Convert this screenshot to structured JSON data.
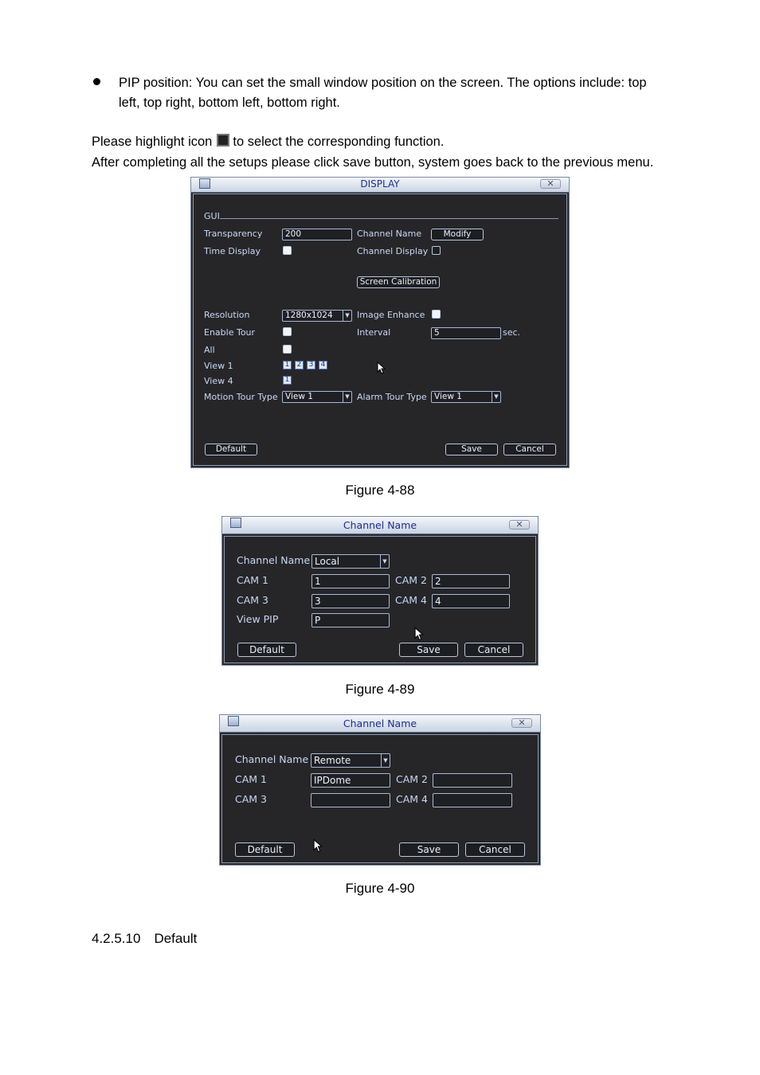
{
  "intro": {
    "bullet_line1": "PIP position: You can set the small window position on the screen. The options include: top",
    "bullet_line2": "left, top right, bottom left, bottom right.",
    "highlight_before": "Please highlight icon",
    "highlight_after": "to select the corresponding function.",
    "save_note": "After completing all the setups please click save button, system goes back to the previous menu."
  },
  "display_window": {
    "title": "DISPLAY",
    "section": "GUI",
    "transparency_label": "Transparency",
    "transparency_value": "200",
    "channel_name_label": "Channel Name",
    "modify_button": "Modify",
    "time_display_label": "Time Display",
    "channel_display_label": "Channel Display",
    "screen_calibration_button": "Screen Calibration",
    "resolution_label": "Resolution",
    "resolution_value": "1280x1024",
    "image_enhance_label": "Image Enhance",
    "enable_tour_label": "Enable Tour",
    "interval_label": "Interval",
    "interval_value": "5",
    "interval_unit": "sec.",
    "all_label": "All",
    "view1_label": "View 1",
    "view1_boxes": [
      "1",
      "2",
      "3",
      "4"
    ],
    "view4_label": "View 4",
    "view4_boxes": [
      "1"
    ],
    "motion_tour_label": "Motion Tour Type",
    "motion_tour_value": "View 1",
    "alarm_tour_label": "Alarm Tour Type",
    "alarm_tour_value": "View 1",
    "default_button": "Default",
    "save_button": "Save",
    "cancel_button": "Cancel"
  },
  "figure_88": "Figure 4-88",
  "channel_local_window": {
    "title": "Channel Name",
    "channel_name_label": "Channel Name",
    "channel_name_value": "Local",
    "cam1_label": "CAM 1",
    "cam1_value": "1",
    "cam2_label": "CAM 2",
    "cam2_value": "2",
    "cam3_label": "CAM 3",
    "cam3_value": "3",
    "cam4_label": "CAM 4",
    "cam4_value": "4",
    "view_pip_label": "View PIP",
    "view_pip_value": "P",
    "default_button": "Default",
    "save_button": "Save",
    "cancel_button": "Cancel"
  },
  "figure_89": "Figure 4-89",
  "channel_remote_window": {
    "title": "Channel Name",
    "channel_name_label": "Channel Name",
    "channel_name_value": "Remote",
    "cam1_label": "CAM 1",
    "cam1_value": "IPDome",
    "cam2_label": "CAM 2",
    "cam2_value": "",
    "cam3_label": "CAM 3",
    "cam3_value": "",
    "cam4_label": "CAM 4",
    "cam4_value": "",
    "default_button": "Default",
    "save_button": "Save",
    "cancel_button": "Cancel"
  },
  "figure_90": "Figure 4-90",
  "section_heading": {
    "number": "4.2.5.10",
    "title": "Default"
  }
}
